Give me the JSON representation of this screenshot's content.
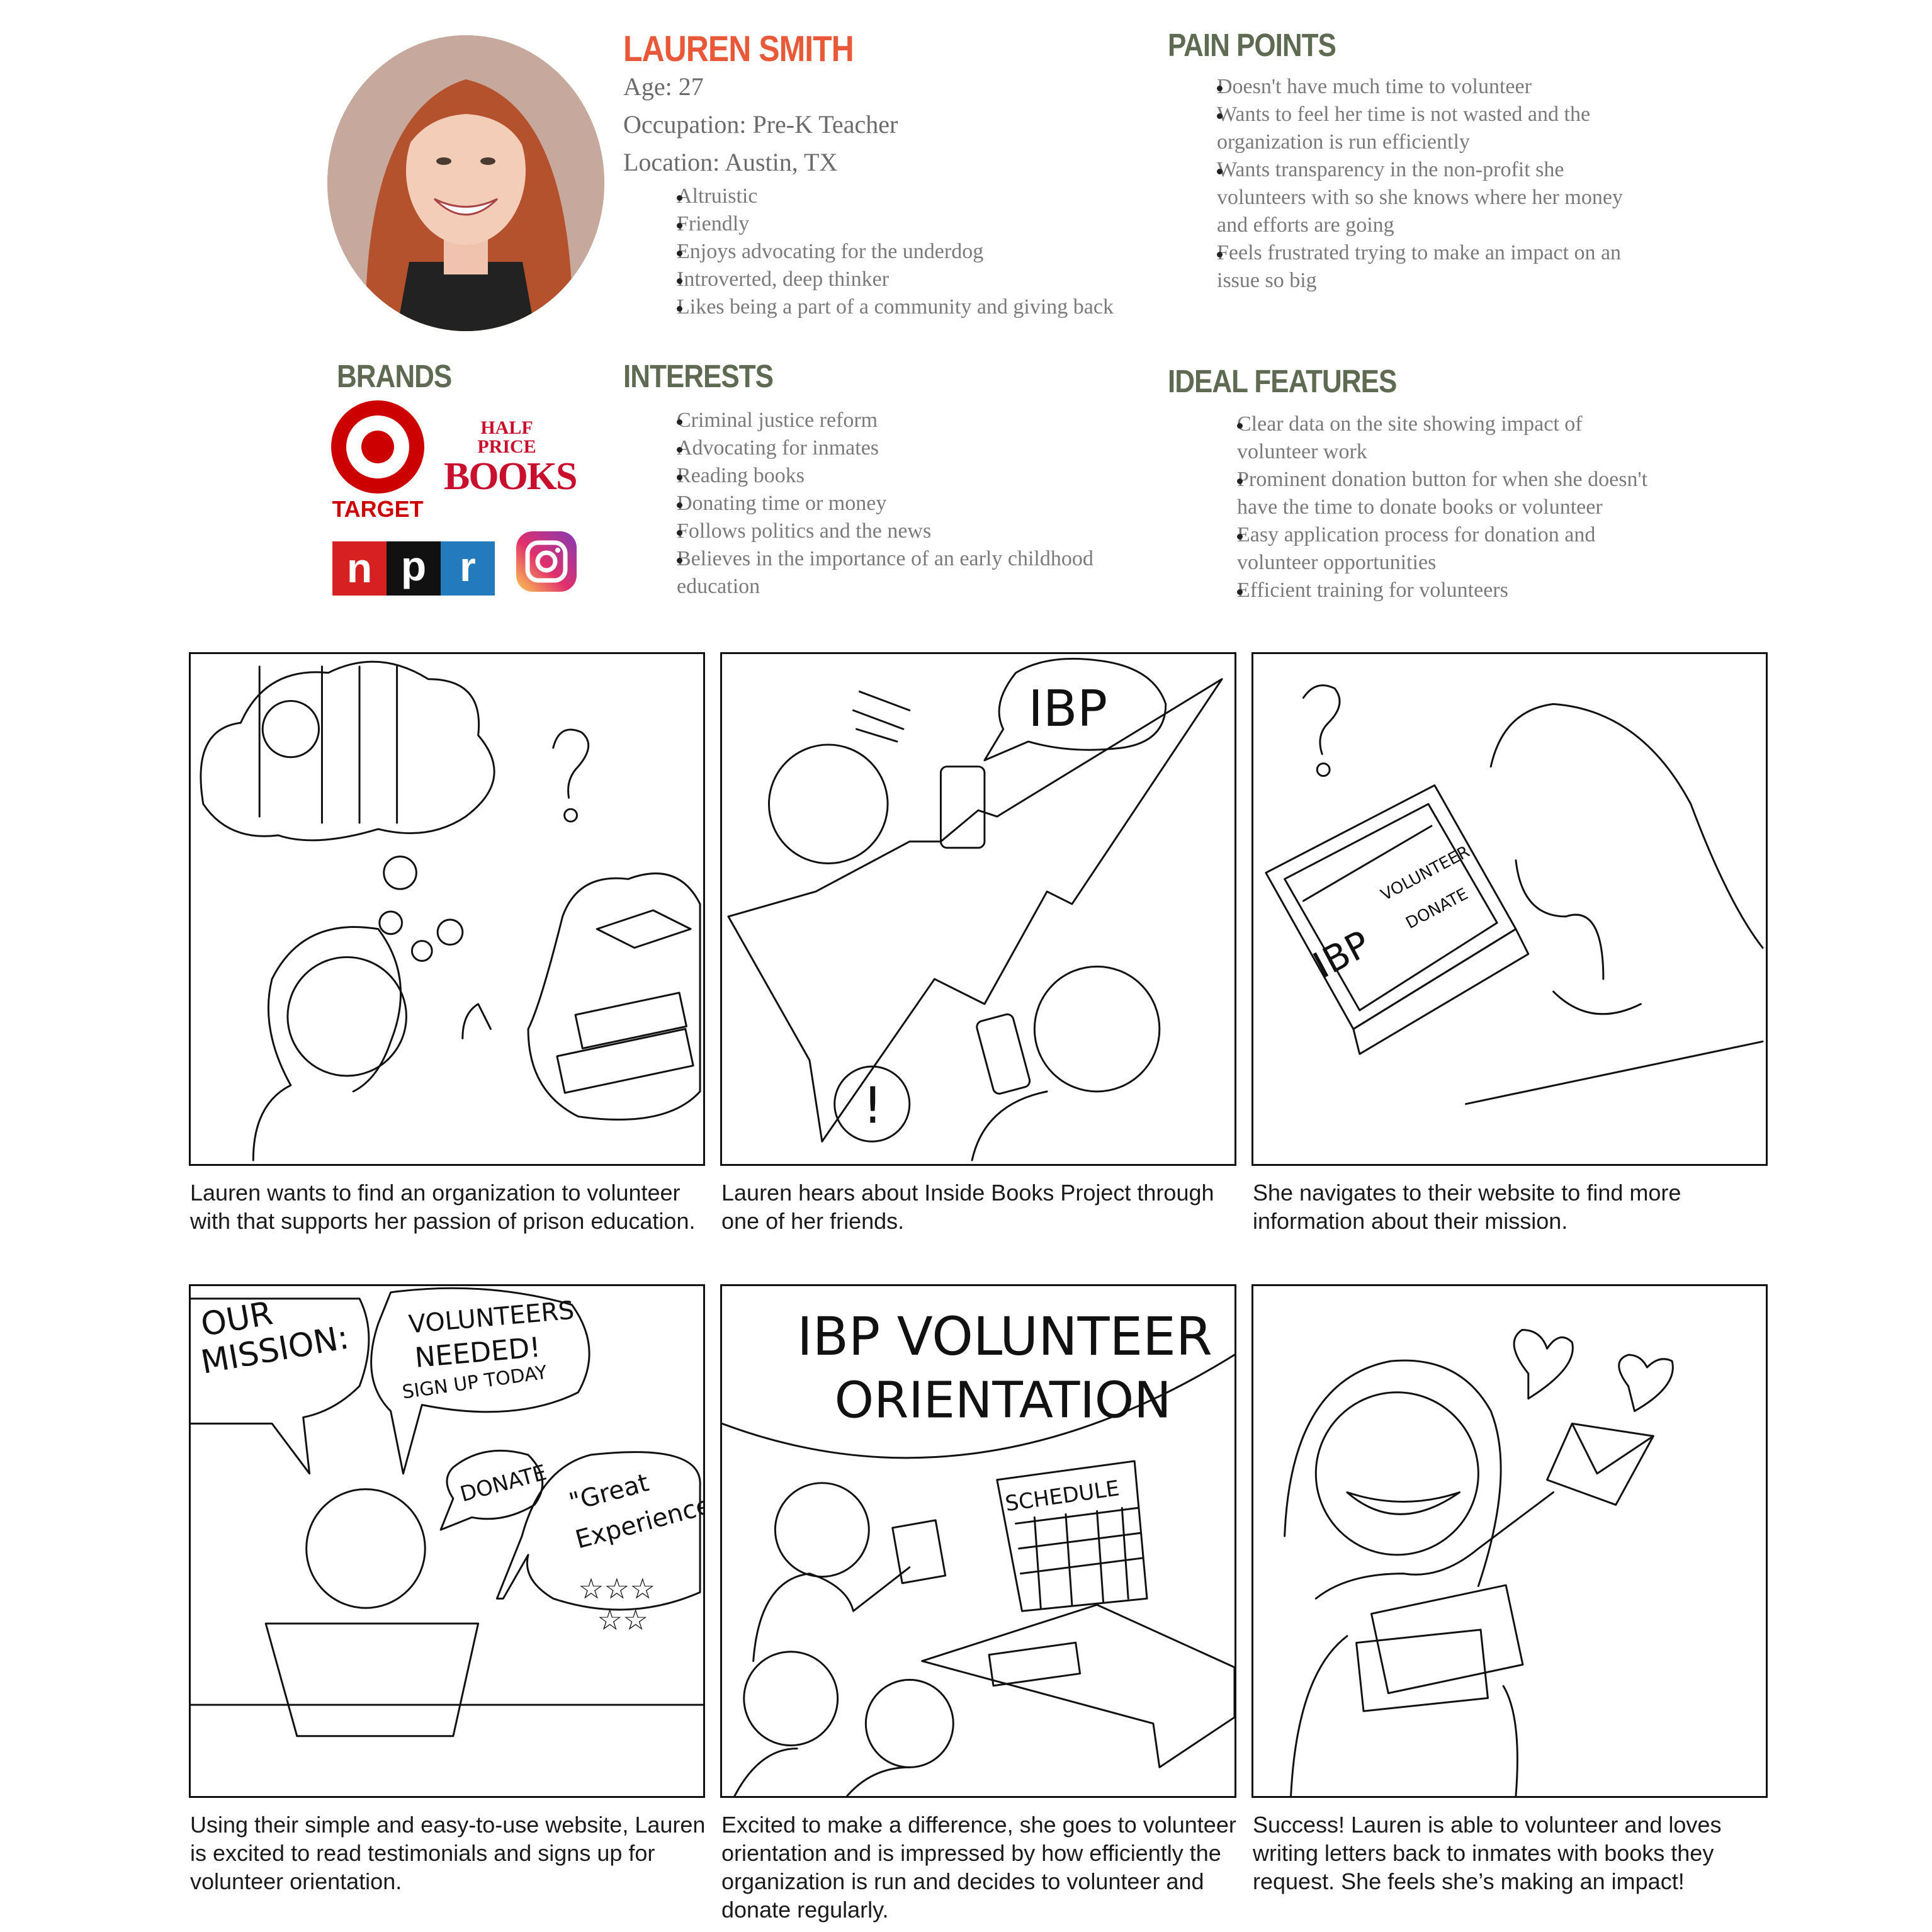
{
  "persona": {
    "name": "LAUREN SMITH",
    "age": "Age: 27",
    "occupation": "Occupation: Pre-K Teacher",
    "location": "Location: Austin, TX",
    "traits": [
      "Altruistic",
      "Friendly",
      "Enjoys advocating for the underdog",
      "Introverted, deep thinker",
      "Likes being a part of a community and giving back"
    ]
  },
  "pain_points": {
    "title": "PAIN POINTS",
    "items": [
      "Doesn't have much time to volunteer",
      "Wants to feel her time is not wasted and the organization is run efficiently",
      "Wants transparency in the non-profit she volunteers with so she knows where her money and efforts are going",
      "Feels frustrated trying to make an impact on an issue so big"
    ]
  },
  "brands": {
    "title": "BRANDS",
    "target_label": "TARGET",
    "hpb_line1": "HALF",
    "hpb_line2": "PRICE",
    "hpb_line3": "BOOKS",
    "npr": [
      "n",
      "p",
      "r"
    ]
  },
  "interests": {
    "title": "INTERESTS",
    "items": [
      "Criminal justice reform",
      "Advocating for inmates",
      "Reading books",
      "Donating time or money",
      "Follows politics and the news",
      "Believes in the importance of an early childhood education"
    ]
  },
  "ideal_features": {
    "title": "IDEAL FEATURES",
    "items": [
      "Clear data on the site showing impact of volunteer work",
      "Prominent donation button for when she doesn't have the time to donate books or volunteer",
      "Easy application process for donation and volunteer opportunities",
      "Efficient training for volunteers"
    ]
  },
  "panels": {
    "p2_bubble": "IBP",
    "p3_screen1": "IBP",
    "p3_screen2": "VOLUNTEER",
    "p3_screen3": "DONATE",
    "p4_mission1": "OUR",
    "p4_mission2": "MISSION:",
    "p4_vol1": "VOLUNTEERS",
    "p4_vol2": "NEEDED!",
    "p4_vol3": "SIGN UP TODAY",
    "p4_donate": "DONATE",
    "p4_quote1": "\"Great",
    "p4_quote2": "Experience\"",
    "p5_title1": "IBP VOLUNTEER",
    "p5_title2": "ORIENTATION",
    "p5_schedule": "SCHEDULE"
  },
  "captions": [
    "Lauren wants to find an organization to volunteer with that supports her passion of prison education.",
    "Lauren hears about Inside Books Project through one of her friends.",
    "She navigates to their website to find more information about their mission.",
    "Using their simple and easy-to-use website, Lauren is excited to read testimonials and signs up for volunteer orientation.",
    "Excited to make a difference, she goes to volunteer orientation and is impressed by how efficiently the organization is run and decides to volunteer and donate regularly.",
    "Success! Lauren is able to volunteer and loves writing letters back to inmates with books they request. She feels she’s making an impact!"
  ],
  "colors": {
    "name": "#e8593a",
    "heading": "#5e6a52",
    "target_red": "#cc0000",
    "npr_red": "#d62021",
    "npr_black": "#111111",
    "npr_blue": "#237bbd"
  }
}
